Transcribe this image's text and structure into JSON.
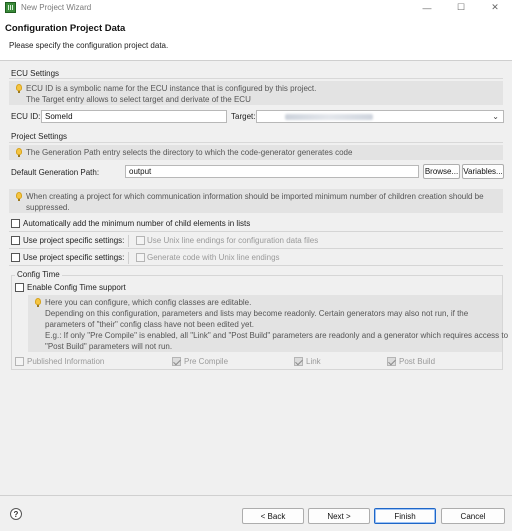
{
  "window": {
    "title": "New Project Wizard",
    "controls": [
      "—",
      "☐",
      "✕"
    ]
  },
  "header": {
    "title": "Configuration Project Data",
    "subtitle": "Please specify the configuration project data."
  },
  "ecu_settings": {
    "title": "ECU Settings",
    "info_line1": "ECU ID is a symbolic name for the ECU instance that is configured by this project.",
    "info_line2": "The Target entry allows to select target and derivate of the ECU",
    "ecu_id_label": "ECU ID:",
    "ecu_id_value": "SomeId",
    "target_label": "Target:"
  },
  "project_settings": {
    "title": "Project Settings",
    "info": "The Generation Path entry selects the directory to which the code-generator generates code",
    "gen_path_label": "Default Generation Path:",
    "gen_path_value": "output",
    "browse_label": "Browse...",
    "variables_label": "Variables...",
    "info2_line1": "When creating a project for which communication information should be imported minimum number of children creation should be",
    "info2_line2": "suppressed.",
    "auto_add_label": "Automatically add the minimum number of child elements in lists",
    "specific1_label": "Use project specific settings:",
    "unix_line_endings_label": "Use Unix line endings for configuration data files",
    "specific2_label": "Use project specific settings:",
    "generate_unix_label": "Generate code with Unix line endings"
  },
  "config_time": {
    "title": "Config Time",
    "enable_label": "Enable Config Time support",
    "info_line1": "Here you can configure, which config classes are editable.",
    "info_line2": "Depending on this configuration, parameters and lists may become readonly. Certain generators may also not run, if the",
    "info_line3": "parameters of \"their\" config class have not been edited yet.",
    "info_line4": "E.g.: If only \"Pre Compile\" is enabled, all \"Link\" and \"Post Build\" parameters are readonly and a generator which requires access to",
    "info_line5": "\"Post Build\" parameters will not run.",
    "published_label": "Published Information",
    "precompile_label": "Pre Compile",
    "link_label": "Link",
    "postbuild_label": "Post Build"
  },
  "footer": {
    "help_label": "?",
    "back_label": "< Back",
    "next_label": "Next >",
    "finish_label": "Finish",
    "cancel_label": "Cancel"
  }
}
